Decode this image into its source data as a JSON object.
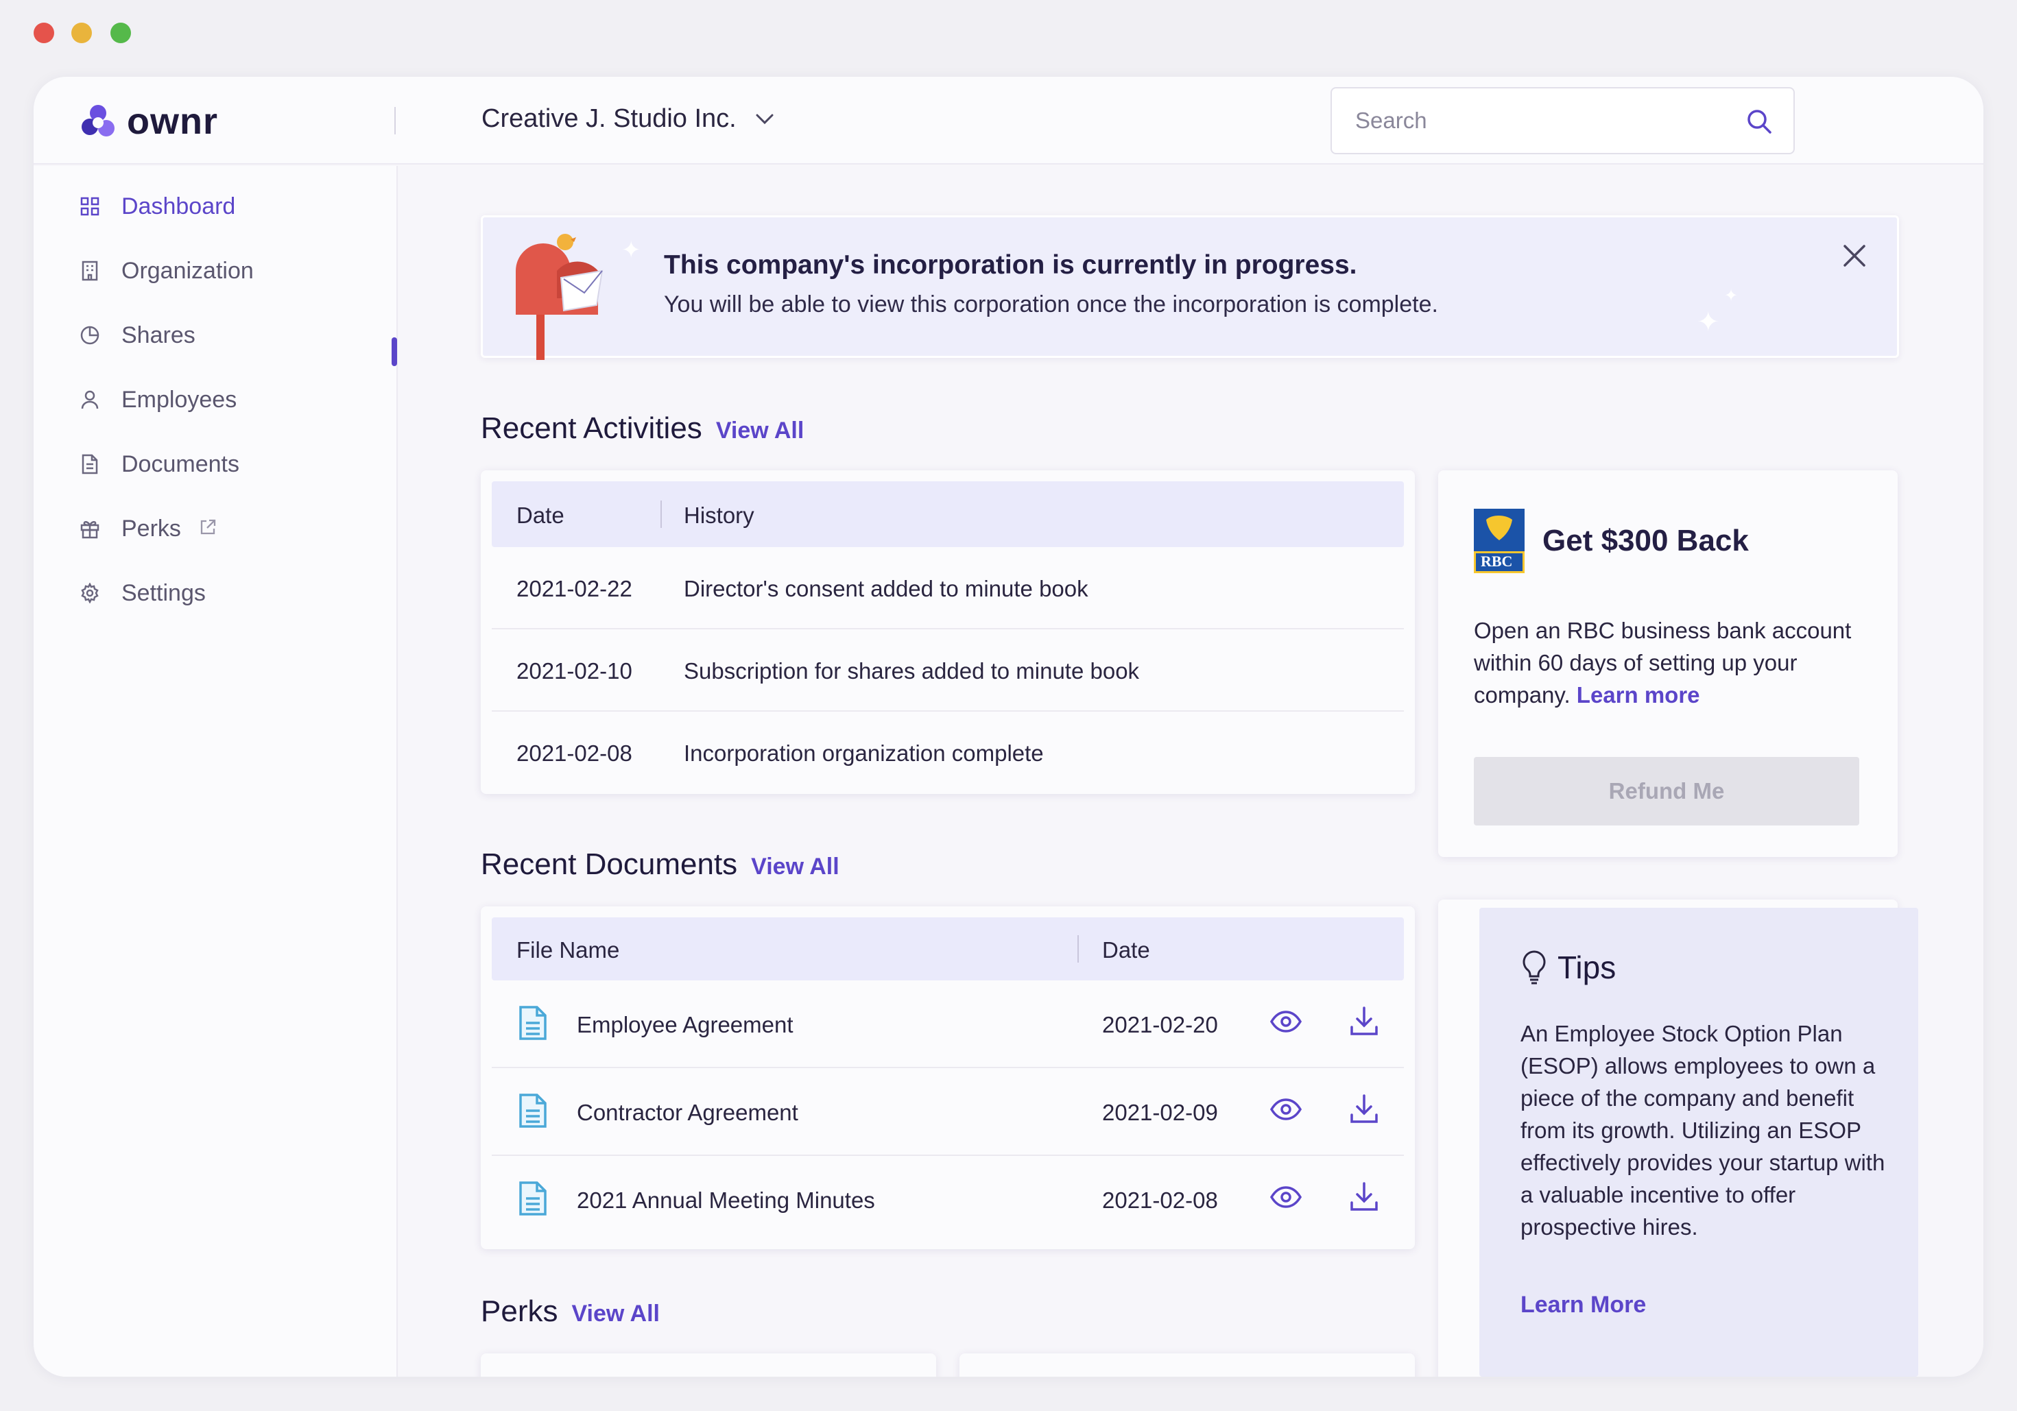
{
  "app": {
    "logo_text": "ownr",
    "company_name": "Creative J. Studio Inc."
  },
  "search": {
    "placeholder": "Search"
  },
  "sidebar": {
    "items": [
      {
        "label": "Dashboard",
        "icon": "grid-icon",
        "active": true
      },
      {
        "label": "Organization",
        "icon": "building-icon"
      },
      {
        "label": "Shares",
        "icon": "pie-chart-icon"
      },
      {
        "label": "Employees",
        "icon": "user-icon"
      },
      {
        "label": "Documents",
        "icon": "document-icon"
      },
      {
        "label": "Perks",
        "icon": "gift-icon",
        "external": true
      },
      {
        "label": "Settings",
        "icon": "gear-icon"
      }
    ]
  },
  "banner": {
    "title": "This company's incorporation is currently in progress.",
    "subtitle": "You will be able to view this corporation once the incorporation is complete."
  },
  "activities": {
    "title": "Recent Activities",
    "view_all": "View All",
    "columns": [
      "Date",
      "History"
    ],
    "rows": [
      {
        "date": "2021-02-22",
        "history": "Director's consent added to minute book"
      },
      {
        "date": "2021-02-10",
        "history": "Subscription for shares added to minute book"
      },
      {
        "date": "2021-02-08",
        "history": "Incorporation organization complete"
      }
    ]
  },
  "documents": {
    "title": "Recent Documents",
    "view_all": "View All",
    "columns": [
      "File Name",
      "Date"
    ],
    "rows": [
      {
        "name": "Employee Agreement",
        "date": "2021-02-20"
      },
      {
        "name": "Contractor Agreement",
        "date": "2021-02-09"
      },
      {
        "name": "2021 Annual Meeting Minutes",
        "date": "2021-02-08"
      }
    ]
  },
  "perks": {
    "title": "Perks",
    "view_all": "View All"
  },
  "promo": {
    "logo_text": "RBC",
    "title": "Get $300 Back",
    "text": "Open an RBC business bank account within 60 days of setting up your company.",
    "link": "Learn more",
    "button": "Refund Me"
  },
  "tips": {
    "title": "Tips",
    "text": "An Employee Stock Option Plan (ESOP) allows employees to own a piece of the company and benefit from its growth. Utilizing an ESOP effectively provides your startup with a valuable incentive to offer prospective hires.",
    "link": "Learn More"
  },
  "colors": {
    "accent": "#5b45c9",
    "table_header": "#eaeafb",
    "banner_bg": "#eeeefb",
    "file_icon": "#4aa8d8"
  }
}
